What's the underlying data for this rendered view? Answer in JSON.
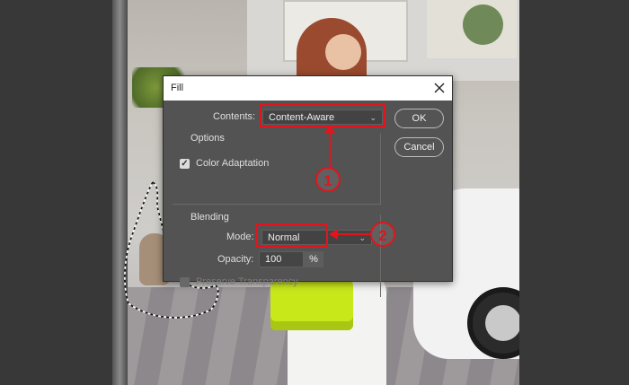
{
  "dialog": {
    "title": "Fill",
    "contents_label": "Contents:",
    "contents_value": "Content-Aware",
    "ok_label": "OK",
    "cancel_label": "Cancel",
    "options_title": "Options",
    "color_adaptation_label": "Color Adaptation",
    "color_adaptation_checked": true,
    "blending_title": "Blending",
    "mode_label": "Mode:",
    "mode_value": "Normal",
    "opacity_label": "Opacity:",
    "opacity_value": "100",
    "opacity_unit": "%",
    "preserve_transparency_label": "Preserve Transparency",
    "preserve_transparency_enabled": false
  },
  "annotations": {
    "marker_1": "1",
    "marker_2": "2",
    "color": "#e3141b"
  },
  "icons": {
    "close": "close-icon",
    "dropdown": "chevron-down-icon",
    "check": "checkmark-icon"
  }
}
